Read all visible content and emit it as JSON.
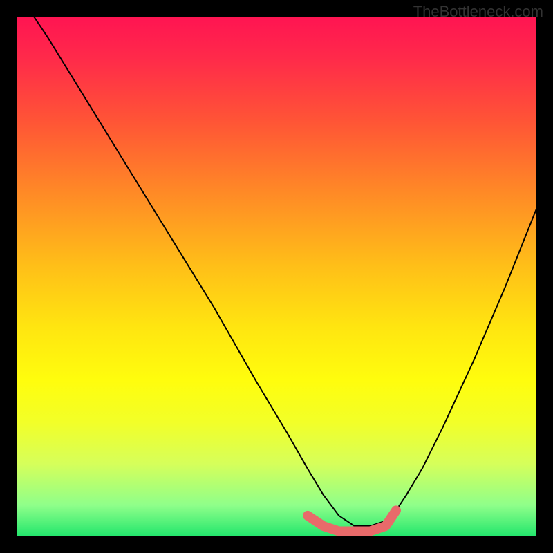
{
  "watermark": "TheBottleneck.com",
  "chart_data": {
    "type": "line",
    "title": "",
    "xlabel": "",
    "ylabel": "",
    "xlim": [
      0,
      100
    ],
    "ylim": [
      0,
      100
    ],
    "series": [
      {
        "name": "bottleneck-curve",
        "color": "#000000",
        "x": [
          0,
          6,
          14,
          22,
          30,
          38,
          46,
          52,
          56,
          59,
          62,
          65,
          68,
          71,
          73,
          75,
          78,
          82,
          88,
          94,
          100
        ],
        "values": [
          105,
          96,
          83,
          70,
          57,
          44,
          30,
          20,
          13,
          8,
          4,
          2,
          2,
          3,
          5,
          8,
          13,
          21,
          34,
          48,
          63
        ]
      },
      {
        "name": "optimal-zone",
        "color": "#e86a6a",
        "x": [
          56,
          59,
          62,
          65,
          68,
          71,
          73
        ],
        "values": [
          4,
          2,
          1,
          1,
          1,
          2,
          5
        ]
      }
    ],
    "gradient_stops": [
      {
        "pos": 0,
        "color": "#ff1452"
      },
      {
        "pos": 8,
        "color": "#ff2a4a"
      },
      {
        "pos": 20,
        "color": "#ff5436"
      },
      {
        "pos": 34,
        "color": "#ff8a26"
      },
      {
        "pos": 48,
        "color": "#ffbf18"
      },
      {
        "pos": 60,
        "color": "#ffe610"
      },
      {
        "pos": 70,
        "color": "#fffd0d"
      },
      {
        "pos": 78,
        "color": "#f2ff28"
      },
      {
        "pos": 86,
        "color": "#d6ff5a"
      },
      {
        "pos": 94,
        "color": "#8fff8a"
      },
      {
        "pos": 100,
        "color": "#22e66c"
      }
    ]
  }
}
